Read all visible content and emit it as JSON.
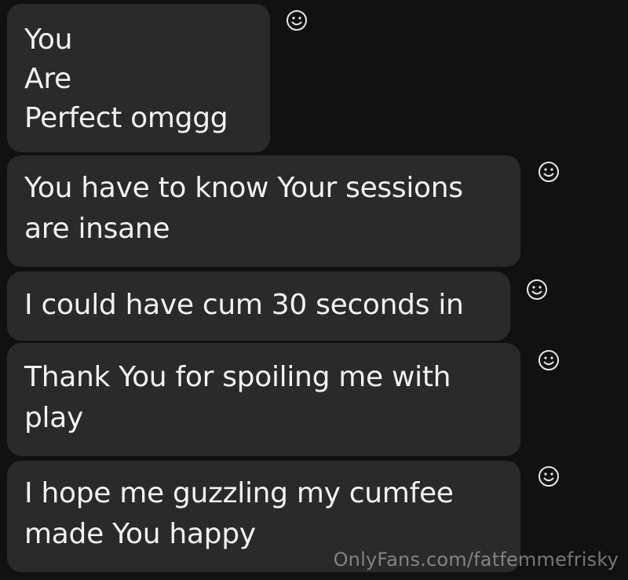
{
  "messages": [
    {
      "text": "You\nAre\nPerfect omggg",
      "reaction_icon": "smiley-icon"
    },
    {
      "text": "You have to know Your sessions\nare insane",
      "reaction_icon": "smiley-icon"
    },
    {
      "text": "I could have cum 30 seconds in",
      "reaction_icon": "smiley-icon"
    },
    {
      "text": "Thank You for spoiling me with\nplay",
      "reaction_icon": "smiley-icon"
    },
    {
      "text": "I hope me guzzling my cumfee\nmade You happy",
      "reaction_icon": "smiley-icon"
    }
  ],
  "watermark": "OnlyFans.com/fatfemmefrisky",
  "colors": {
    "background": "#111111",
    "bubble": "#2a2a2a",
    "text": "#f2f2f2"
  }
}
